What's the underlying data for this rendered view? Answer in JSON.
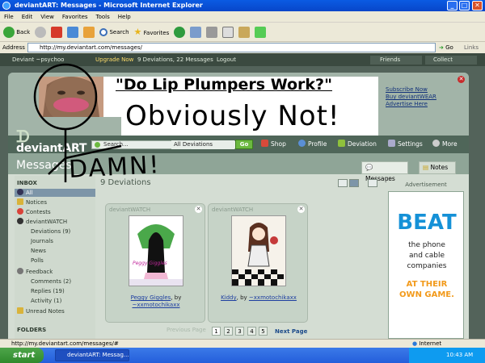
{
  "window": {
    "title": "deviantART: Messages - Microsoft Internet Explorer"
  },
  "menu": [
    "File",
    "Edit",
    "View",
    "Favorites",
    "Tools",
    "Help"
  ],
  "toolbar": {
    "back": "Back",
    "search": "Search",
    "favorites": "Favorites"
  },
  "address": {
    "label": "Address",
    "url": "http://my.deviantart.com/messages/",
    "go": "Go",
    "links": "Links"
  },
  "userbar": {
    "text": "Deviant ~psychoo",
    "upgrade": "Upgrade Now",
    "stats": "9 Deviations, 22 Messages",
    "logout": "Logout",
    "friends": "Friends",
    "collect": "Collect"
  },
  "banner": {
    "links": [
      "Subscribe Now",
      "Buy deviantWEAR",
      "Advertise Here"
    ]
  },
  "annotations": {
    "headline": "\"Do Lip Plumpers Work?\"",
    "answer": "Obviously Not!",
    "damn": "DAMN!"
  },
  "nav": {
    "logo": "deviantART",
    "search_placeholder": "Search...",
    "search_scope": "All Deviations",
    "go": "Go",
    "shop": "Shop",
    "profile": "Profile",
    "deviation": "Deviation",
    "settings": "Settings",
    "more": "More"
  },
  "messages": {
    "title": "Messages",
    "tab_messages": "Messages",
    "tab_notes": "Notes",
    "count": "9 Deviations",
    "advertisement": "Advertisement"
  },
  "sidebar": {
    "inbox": "INBOX",
    "items": [
      "All",
      "Notices",
      "Contests",
      "deviantWATCH",
      "Deviations (9)",
      "Journals",
      "News",
      "Polls",
      "Feedback",
      "Comments (2)",
      "Replies (19)",
      "Activity (1)",
      "Unread Notes"
    ],
    "folders": "FOLDERS"
  },
  "cards": [
    {
      "label": "deviantWATCH",
      "title": "Peggy Giggles",
      "by": ", by",
      "author": "~xxmotochikaxx",
      "art_text": "Peggy Giggles"
    },
    {
      "label": "deviantWATCH",
      "title": "Kiddy",
      "by": ", by",
      "author": "~xxmotochikaxx"
    }
  ],
  "pager": {
    "prev": "Previous Page",
    "pages": [
      "1",
      "2",
      "3",
      "4",
      "5"
    ],
    "next": "Next Page"
  },
  "ad": {
    "big": "BEAT",
    "line1": "the phone",
    "line2": "and cable",
    "line3": "companies",
    "line4": "AT THEIR",
    "line5": "OWN GAME."
  },
  "status": {
    "url": "http://my.deviantart.com/messages/#",
    "zone": "Internet"
  },
  "taskbar": {
    "start": "start",
    "item": "deviantART: Messag...",
    "time": "10:43 AM"
  },
  "colors": {
    "accent": "#6bb93f",
    "ad_blue": "#1591d7",
    "ad_orange": "#f29a1b",
    "title_blue": "#0a5be3"
  }
}
